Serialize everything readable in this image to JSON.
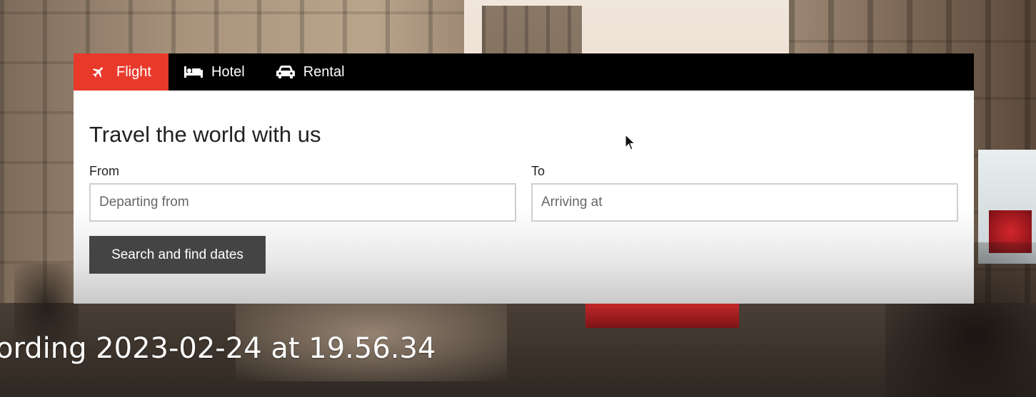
{
  "tabs": [
    {
      "label": "Flight",
      "icon": "plane-icon",
      "active": true
    },
    {
      "label": "Hotel",
      "icon": "bed-icon",
      "active": false
    },
    {
      "label": "Rental",
      "icon": "car-icon",
      "active": false
    }
  ],
  "panel": {
    "title": "Travel the world with us",
    "from": {
      "label": "From",
      "placeholder": "Departing from",
      "value": ""
    },
    "to": {
      "label": "To",
      "placeholder": "Arriving at",
      "value": ""
    },
    "search_button": "Search and find dates"
  },
  "overlay": {
    "recording_text": "ording 2023-02-24 at 19.56.34"
  },
  "colors": {
    "accent": "#e8392b",
    "tabbar": "#000000",
    "button": "#444444"
  }
}
